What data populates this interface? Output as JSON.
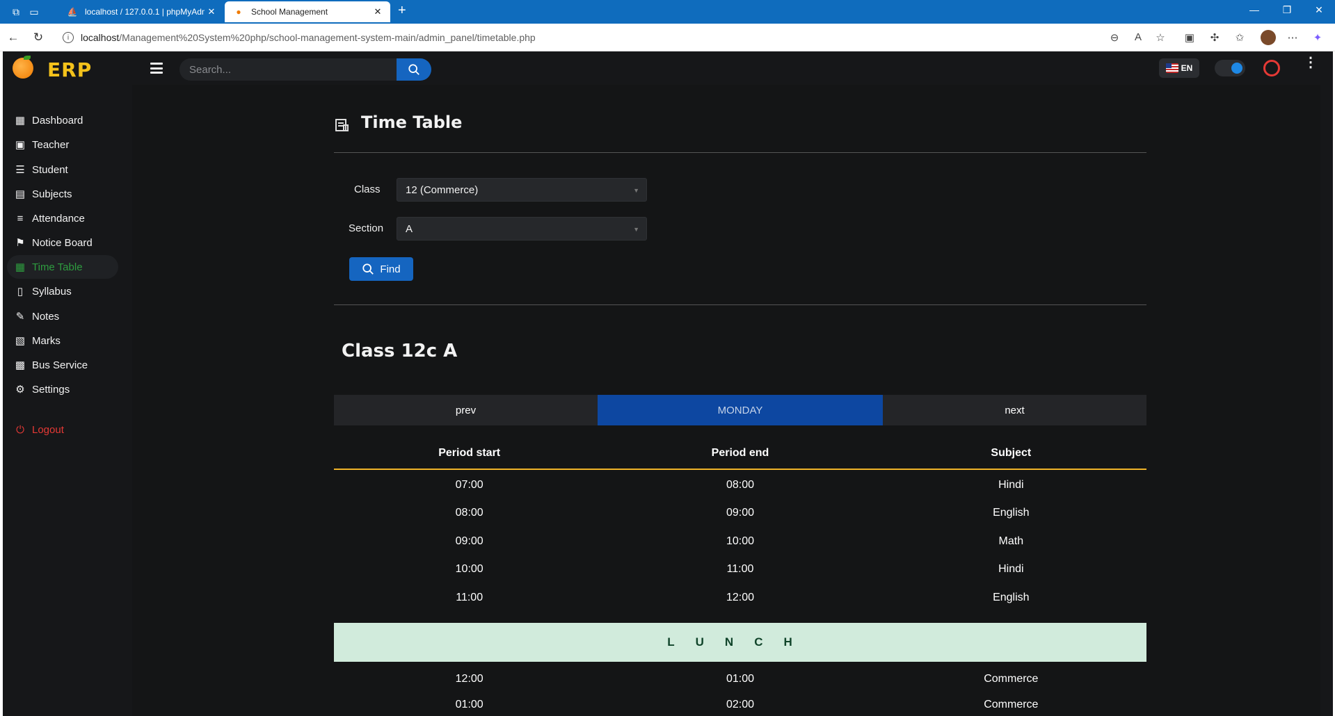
{
  "browser": {
    "tabs": [
      {
        "title": "localhost / 127.0.0.1 | phpMyAdmin",
        "active": false
      },
      {
        "title": "School Management",
        "active": true
      }
    ],
    "url_host": "localhost",
    "url_path": "/Management%20System%20php/school-management-system-main/admin_panel/timetable.php"
  },
  "app": {
    "brand": "ERP",
    "search": {
      "placeholder": "Search..."
    },
    "language": "EN"
  },
  "sidebar": {
    "items": [
      {
        "label": "Dashboard",
        "icon": "dashboard-icon"
      },
      {
        "label": "Teacher",
        "icon": "teacher-icon"
      },
      {
        "label": "Student",
        "icon": "student-icon"
      },
      {
        "label": "Subjects",
        "icon": "book-icon"
      },
      {
        "label": "Attendance",
        "icon": "attendance-icon"
      },
      {
        "label": "Notice Board",
        "icon": "bookmark-icon"
      },
      {
        "label": "Time Table",
        "icon": "grid-icon",
        "active": true
      },
      {
        "label": "Syllabus",
        "icon": "file-icon"
      },
      {
        "label": "Notes",
        "icon": "notes-icon"
      },
      {
        "label": "Marks",
        "icon": "marks-icon"
      },
      {
        "label": "Bus Service",
        "icon": "bus-icon"
      },
      {
        "label": "Settings",
        "icon": "gear-icon"
      }
    ],
    "logout": "Logout"
  },
  "page": {
    "title": "Time Table",
    "form": {
      "class_label": "Class",
      "class_value": "12 (Commerce)",
      "section_label": "Section",
      "section_value": "A",
      "find_label": "Find"
    },
    "class_heading": "Class 12c A",
    "day_nav": {
      "prev": "prev",
      "day": "MONDAY",
      "next": "next"
    },
    "table": {
      "headers": [
        "Period start",
        "Period end",
        "Subject"
      ],
      "rows": [
        [
          "07:00",
          "08:00",
          "Hindi"
        ],
        [
          "08:00",
          "09:00",
          "English"
        ],
        [
          "09:00",
          "10:00",
          "Math"
        ],
        [
          "10:00",
          "11:00",
          "Hindi"
        ],
        [
          "11:00",
          "12:00",
          "English"
        ]
      ],
      "lunch": "LUNCH",
      "after_lunch": [
        [
          "12:00",
          "01:00",
          "Commerce"
        ],
        [
          "01:00",
          "02:00",
          "Commerce"
        ]
      ]
    }
  },
  "colors": {
    "accent": "#1565c0",
    "active_nav": "#2e9c3f",
    "brand": "#f4c21b",
    "logout": "#e53935",
    "table_rule": "#f0b429",
    "lunch_bg": "#d1ebdc"
  }
}
